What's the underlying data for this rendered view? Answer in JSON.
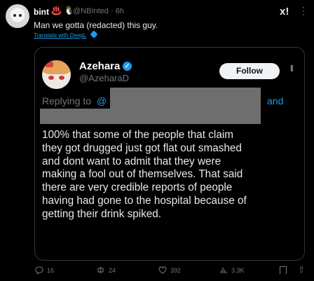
{
  "header": {
    "name": "bint",
    "emojis": "♨️ 🐧",
    "handle": "@NBInted · 6h",
    "text": "Man we gotta (redacted) this guy.",
    "translate": "Translate with DeepL",
    "top_icon": "x!"
  },
  "quote": {
    "name": "Azehara",
    "handle": "@AzeharaD",
    "follow": "Follow",
    "replying_prefix": "Replying to",
    "replying_at": "@",
    "replying_and": "and",
    "body": "100% that some of the people that claim\nthey got drugged just got flat out smashed\nand dont want to admit that they were\nmaking a fool out of themselves.  That said\nthere are very credible reports of people\nhaving had gone to the hospital because of\ngetting their drink spiked."
  },
  "actions": {
    "replies": "16",
    "reposts": "24",
    "likes": "392",
    "views": "3.3K"
  },
  "icons": {
    "reply": "reply-icon",
    "repost": "repost-icon",
    "like": "heart-icon",
    "views": "views-icon",
    "bookmark": "bookmark-icon",
    "share": "share-icon",
    "verified": "verified-badge-icon"
  }
}
